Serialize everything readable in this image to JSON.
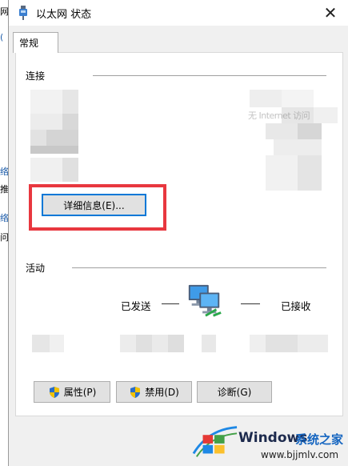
{
  "background_window": {
    "chars": [
      "网",
      "(",
      "络",
      "推",
      "络",
      "问"
    ]
  },
  "window": {
    "title": "以太网 状态",
    "close_label": "✕"
  },
  "tabs": [
    {
      "label": "常规"
    }
  ],
  "connection": {
    "heading": "连接",
    "details_button": "详细信息(E)...",
    "obscured_label": "无 Internet 访问"
  },
  "activity": {
    "heading": "活动",
    "sent_label": "已发送",
    "received_label": "已接收"
  },
  "buttons": {
    "properties": "属性(P)",
    "disable": "禁用(D)",
    "diagnose": "诊断(G)"
  },
  "watermark": {
    "brand": "Windows",
    "site_name": "系统之家",
    "url": "www.bjjmlv.com"
  },
  "colors": {
    "highlight_box": "#e8373f",
    "default_button_border": "#0078d7",
    "link_text": "#1a5aa8"
  },
  "icons": {
    "title": "ethernet-adapter-icon",
    "close": "close-icon",
    "shield": "uac-shield-icon",
    "network": "network-computers-icon",
    "watermark": "windows-logo-icon"
  }
}
